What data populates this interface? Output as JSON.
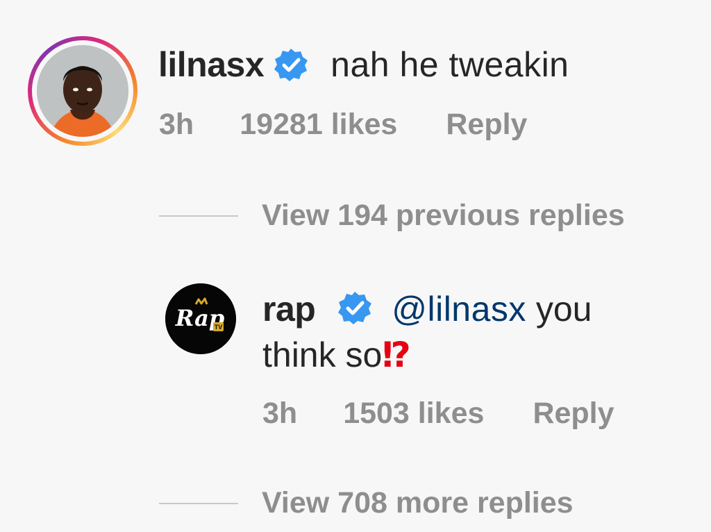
{
  "comment": {
    "username": "lilnasx",
    "verified_icon": "verified-badge-icon",
    "text": "nah he tweakin",
    "time": "3h",
    "likes": "19281 likes",
    "reply_label": "Reply",
    "view_replies": "View 194 previous replies"
  },
  "reply": {
    "username": "rap",
    "verified_icon": "verified-badge-icon",
    "mention": "@lilnasx",
    "text_before_emoji": " you think so",
    "emoji": "⁉",
    "time": "3h",
    "likes": "1503 likes",
    "reply_label": "Reply",
    "view_replies": "View 708 more replies",
    "avatar_logo": "Rap"
  },
  "colors": {
    "background": "#f7f7f7",
    "text": "#262626",
    "muted": "#8e8e8e",
    "mention": "#00376b",
    "verified": "#3897f0",
    "emoji": "#e60012"
  }
}
